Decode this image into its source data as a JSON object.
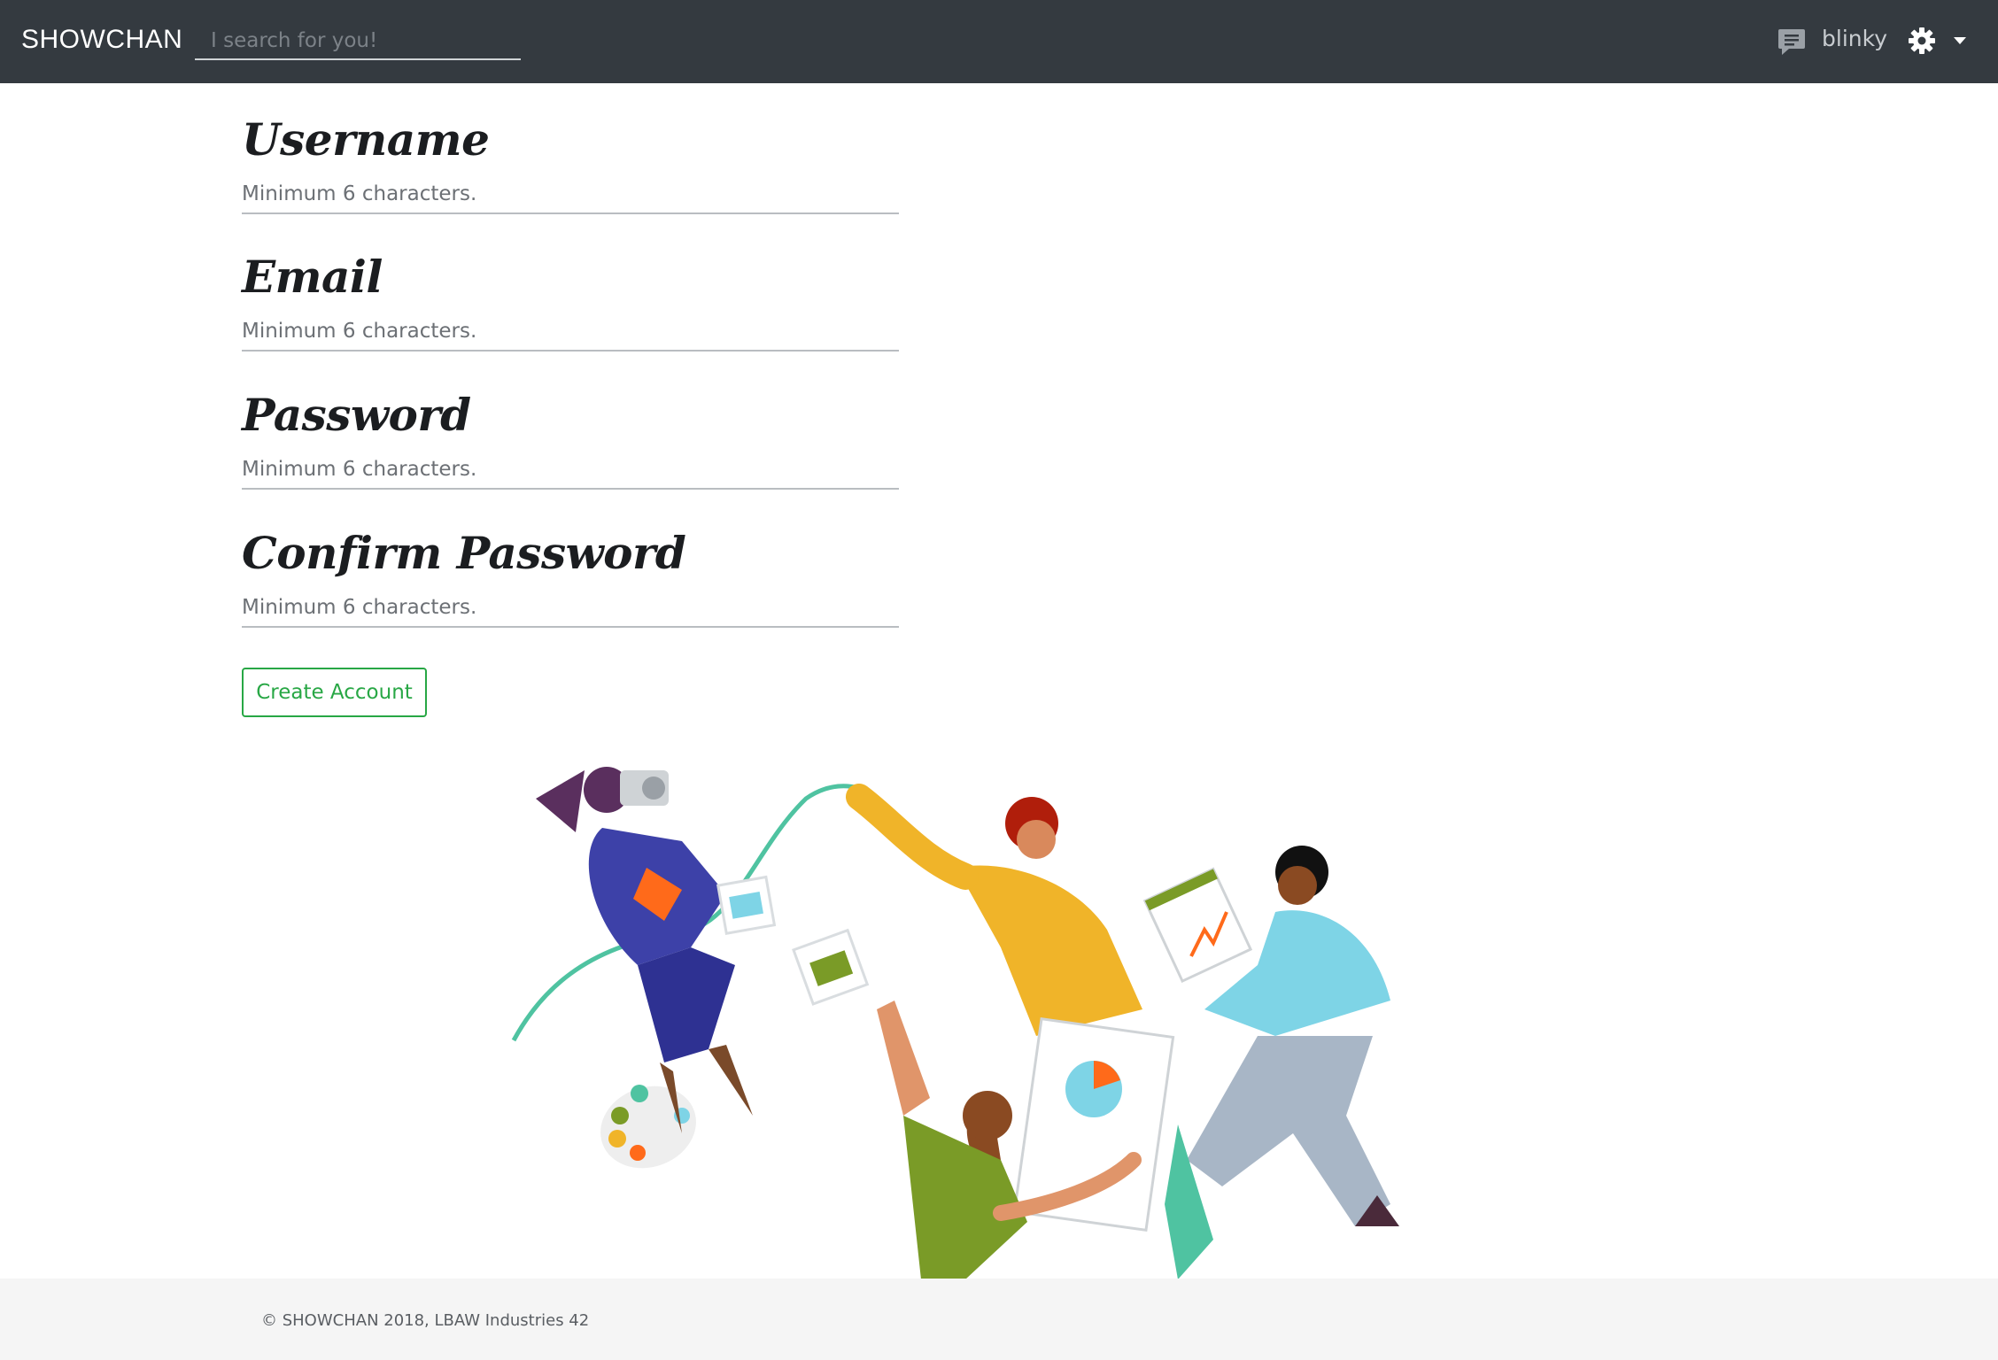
{
  "navbar": {
    "brand": "SHOWCHAN",
    "search_placeholder": "I search for you!",
    "username": "blinky",
    "icons": [
      "chat-icon",
      "gear-icon",
      "caret-down-icon"
    ]
  },
  "form": {
    "fields": [
      {
        "label": "Username",
        "placeholder": "Minimum 6 characters."
      },
      {
        "label": "Email",
        "placeholder": "Minimum 6 characters."
      },
      {
        "label": "Password",
        "placeholder": "Minimum 6 characters."
      },
      {
        "label": "Confirm Password",
        "placeholder": "Minimum 6 characters."
      }
    ],
    "submit_label": "Create Account"
  },
  "colors": {
    "navbar_bg": "#343a40",
    "accent_green": "#28a745",
    "footer_bg": "#f5f5f5"
  },
  "footer": {
    "copyright": "© SHOWCHAN 2018, LBAW Industries 42"
  }
}
